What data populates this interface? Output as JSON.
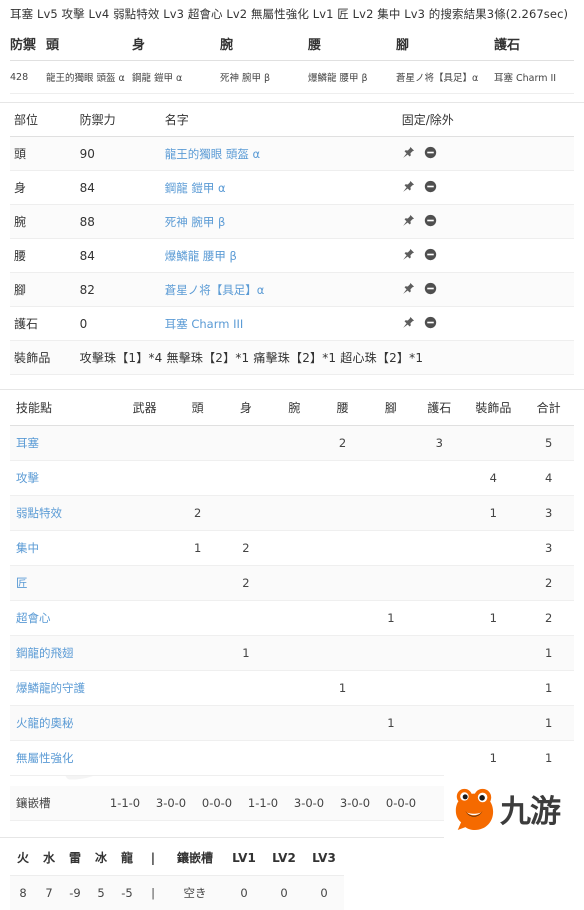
{
  "search": {
    "headline": "耳塞 Lv5 攻擊 Lv4 弱點特效 Lv3 超會心 Lv2 無屬性強化 Lv1 匠 Lv2 集中 Lv3 的搜索結果3條(2.267sec)"
  },
  "equipment_summary": {
    "headers": [
      "防禦",
      "頭",
      "身",
      "腕",
      "腰",
      "腳",
      "護石"
    ],
    "row": {
      "defense": "428",
      "head": "龍王的獨眼 頭盔 α",
      "body": "鋼龍 鎧甲 α",
      "arms": "死神 腕甲 β",
      "waist": "爆鱗龍 腰甲 β",
      "legs": "蒼星ノ将【具足】α",
      "charm": "耳塞 Charm II"
    }
  },
  "parts_table": {
    "headers": [
      "部位",
      "防禦力",
      "名字",
      "固定/除外"
    ],
    "rows": [
      {
        "part": "頭",
        "defense": "90",
        "name": "龍王的獨眼 頭盔 α"
      },
      {
        "part": "身",
        "defense": "84",
        "name": "鋼龍 鎧甲 α"
      },
      {
        "part": "腕",
        "defense": "88",
        "name": "死神 腕甲 β"
      },
      {
        "part": "腰",
        "defense": "84",
        "name": "爆鱗龍 腰甲 β"
      },
      {
        "part": "腳",
        "defense": "82",
        "name": "蒼星ノ将【具足】α"
      },
      {
        "part": "護石",
        "defense": "0",
        "name": "耳塞 Charm III"
      }
    ],
    "decorations_label": "裝飾品",
    "decorations_value": "攻擊珠【1】*4 無擊珠【2】*1 痛擊珠【2】*1 超心珠【2】*1",
    "icons": {
      "pin": "pin-icon",
      "exclude": "minus-circle-icon"
    }
  },
  "skills_table": {
    "headers": [
      "技能點",
      "武器",
      "頭",
      "身",
      "腕",
      "腰",
      "腳",
      "護石",
      "裝飾品",
      "合計"
    ],
    "rows": [
      {
        "name": "耳塞",
        "weapon": "",
        "head": "",
        "body": "",
        "arms": "",
        "waist": "2",
        "legs": "",
        "charm": "3",
        "deco": "",
        "total": "5"
      },
      {
        "name": "攻擊",
        "weapon": "",
        "head": "",
        "body": "",
        "arms": "",
        "waist": "",
        "legs": "",
        "charm": "",
        "deco": "4",
        "total": "4"
      },
      {
        "name": "弱點特效",
        "weapon": "",
        "head": "2",
        "body": "",
        "arms": "",
        "waist": "",
        "legs": "",
        "charm": "",
        "deco": "1",
        "total": "3"
      },
      {
        "name": "集中",
        "weapon": "",
        "head": "1",
        "body": "2",
        "arms": "",
        "waist": "",
        "legs": "",
        "charm": "",
        "deco": "",
        "total": "3"
      },
      {
        "name": "匠",
        "weapon": "",
        "head": "",
        "body": "2",
        "arms": "",
        "waist": "",
        "legs": "",
        "charm": "",
        "deco": "",
        "total": "2"
      },
      {
        "name": "超會心",
        "weapon": "",
        "head": "",
        "body": "",
        "arms": "",
        "waist": "",
        "legs": "1",
        "charm": "",
        "deco": "1",
        "total": "2"
      },
      {
        "name": "鋼龍的飛翅",
        "weapon": "",
        "head": "",
        "body": "1",
        "arms": "",
        "waist": "",
        "legs": "",
        "charm": "",
        "deco": "",
        "total": "1"
      },
      {
        "name": "爆鱗龍的守護",
        "weapon": "",
        "head": "",
        "body": "",
        "arms": "",
        "waist": "1",
        "legs": "",
        "charm": "",
        "deco": "",
        "total": "1"
      },
      {
        "name": "火龍的奧秘",
        "weapon": "",
        "head": "",
        "body": "",
        "arms": "",
        "waist": "",
        "legs": "1",
        "charm": "",
        "deco": "",
        "total": "1"
      },
      {
        "name": "無屬性強化",
        "weapon": "",
        "head": "",
        "body": "",
        "arms": "",
        "waist": "",
        "legs": "",
        "charm": "",
        "deco": "1",
        "total": "1"
      }
    ]
  },
  "slots_row": {
    "label": "鑲嵌槽",
    "values": [
      "1-1-0",
      "3-0-0",
      "0-0-0",
      "1-1-0",
      "3-0-0",
      "3-0-0",
      "0-0-0"
    ]
  },
  "resistances": {
    "headers": [
      "火",
      "水",
      "雷",
      "冰",
      "龍",
      "|",
      "鑲嵌槽",
      "LV1",
      "LV2",
      "LV3"
    ],
    "values": [
      "8",
      "7",
      "-9",
      "5",
      "-5",
      "|",
      "空き",
      "0",
      "0",
      "0"
    ]
  },
  "brand": {
    "name": "九游",
    "mascot_icon": "mascot-icon",
    "color": "#f56a00"
  }
}
